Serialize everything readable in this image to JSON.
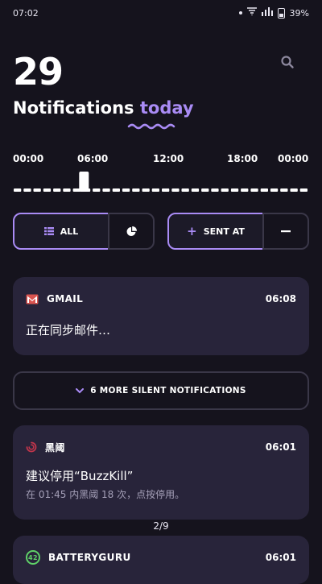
{
  "status_bar": {
    "time": "07:02",
    "battery": "39%"
  },
  "header": {
    "count": "29",
    "title_main": "Notifications",
    "title_accent": "today"
  },
  "timeline": {
    "labels": [
      "00:00",
      "06:00",
      "12:00",
      "18:00",
      "00:00"
    ],
    "current_position": 0.24
  },
  "filters": {
    "all_label": "ALL",
    "sent_at_label": "+ SENT AT",
    "sent_at_text": "SENT AT"
  },
  "notifications": [
    {
      "app": "GMAIL",
      "time": "06:08",
      "title": "正在同步邮件…",
      "subtitle": ""
    },
    {
      "app": "黑阈",
      "time": "06:01",
      "title": "建议停用“BuzzKill”",
      "subtitle": "在 01:45 内黑阈 18 次，点按停用。"
    },
    {
      "app": "BATTERYGURU",
      "time": "06:01",
      "title": "",
      "subtitle": "",
      "badge": "42"
    }
  ],
  "silent": {
    "label": "6 MORE SILENT NOTIFICATIONS"
  },
  "pager": {
    "text": "2/9"
  },
  "colors": {
    "accent": "#a98bf5",
    "background": "#15131d",
    "card": "#28243a"
  }
}
